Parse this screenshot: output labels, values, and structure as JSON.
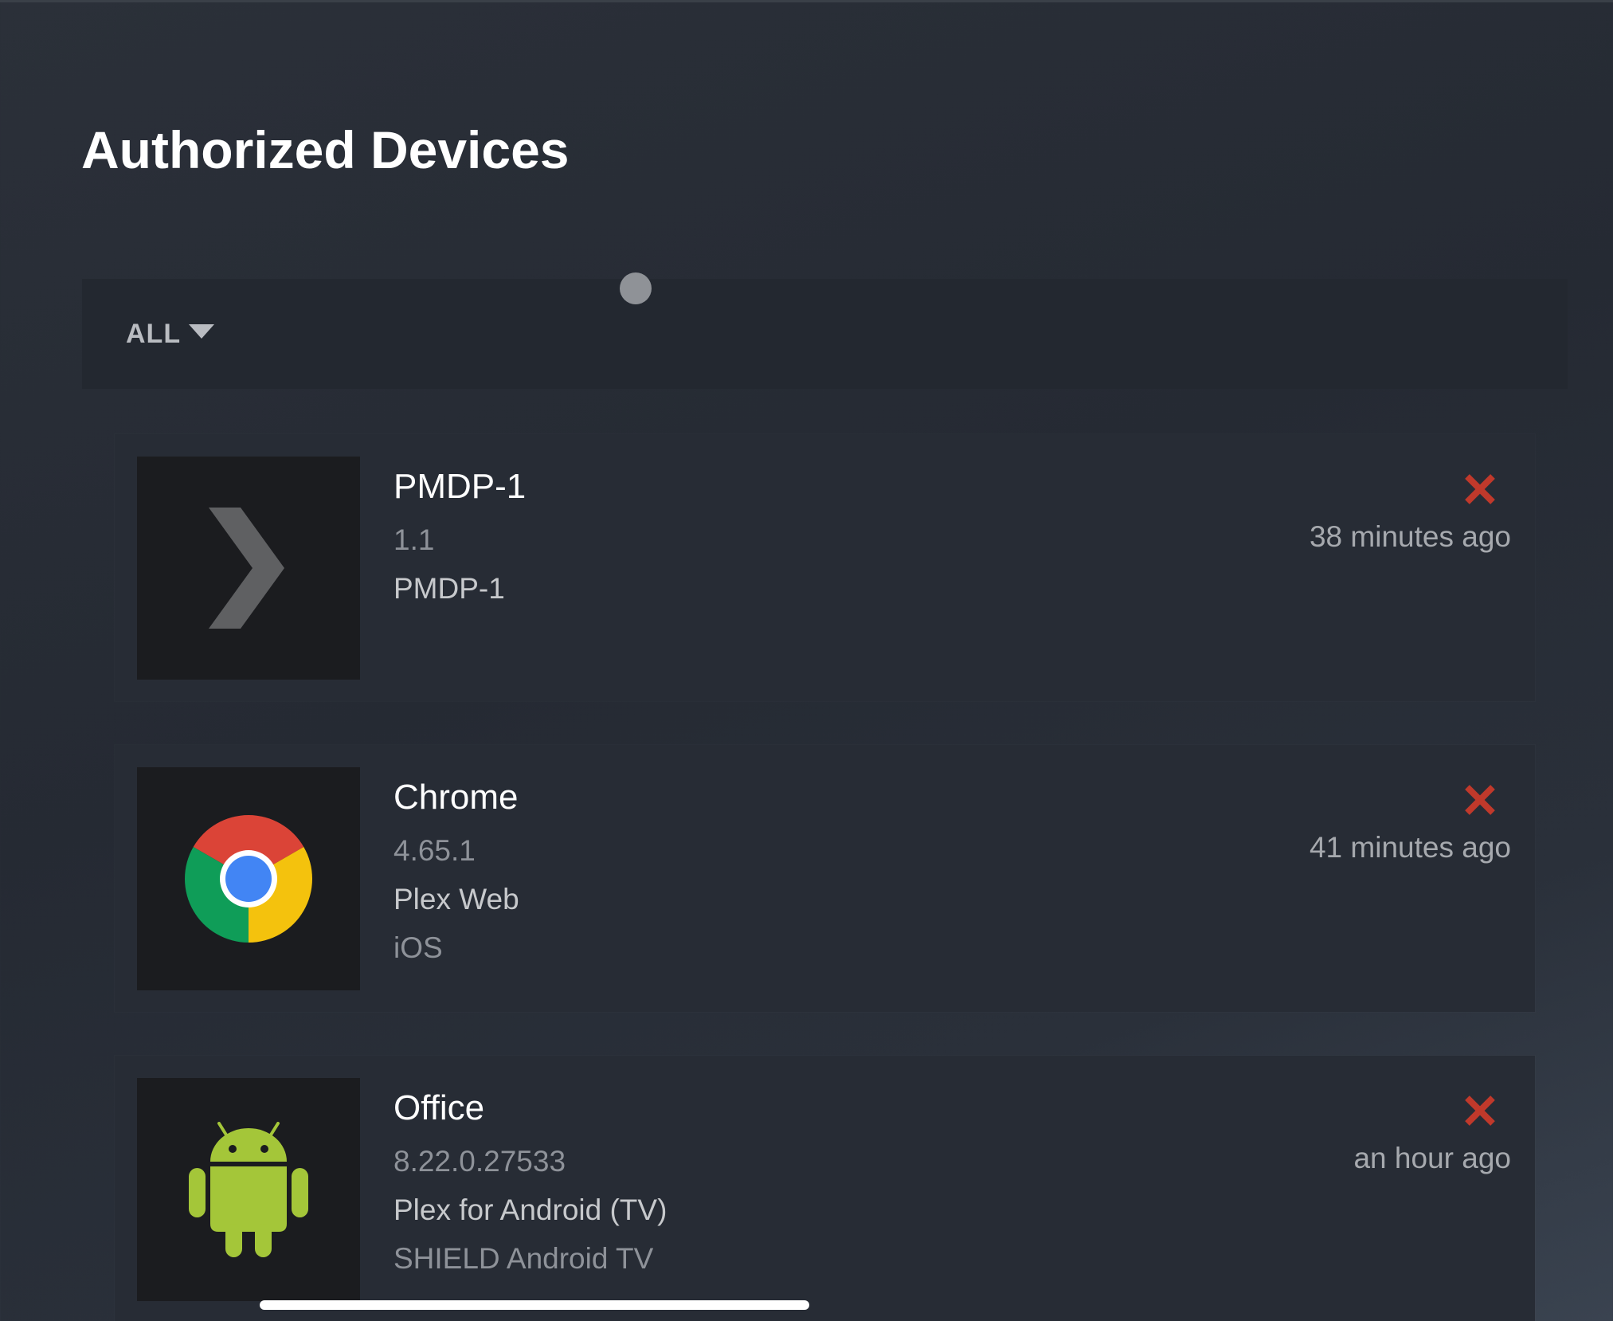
{
  "page": {
    "title": "Authorized Devices"
  },
  "filter": {
    "label": "ALL"
  },
  "devices": [
    {
      "name": "PMDP-1",
      "version": "1.1",
      "product": "PMDP-1",
      "platform": "",
      "last_seen": "38 minutes ago",
      "icon": "plex-chevron-icon"
    },
    {
      "name": "Chrome",
      "version": "4.65.1",
      "product": "Plex Web",
      "platform": "iOS",
      "last_seen": "41 minutes ago",
      "icon": "chrome-icon"
    },
    {
      "name": "Office",
      "version": "8.22.0.27533",
      "product": "Plex for Android (TV)",
      "platform": "SHIELD Android TV",
      "last_seen": "an hour ago",
      "icon": "android-icon"
    }
  ],
  "colors": {
    "remove": "#c0392b",
    "plex_chevron": "#5f6062",
    "android_green": "#a4c639",
    "chrome_red": "#db4437",
    "chrome_yellow": "#f4c20d",
    "chrome_green": "#0f9d58",
    "chrome_blue": "#4285f4"
  }
}
